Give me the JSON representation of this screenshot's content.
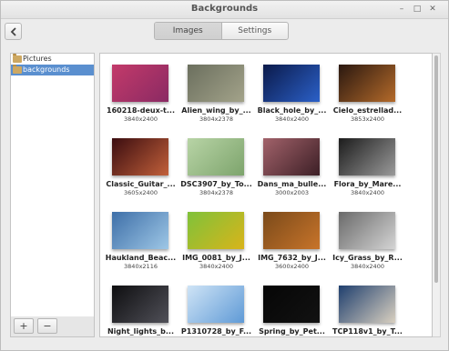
{
  "window": {
    "title": "Backgrounds"
  },
  "toolbar": {
    "tabs": [
      "Images",
      "Settings"
    ],
    "active_tab": "Images"
  },
  "sidebar": {
    "items": [
      {
        "label": "Pictures",
        "icon": "folder-icon"
      },
      {
        "label": "backgrounds",
        "icon": "folder-icon"
      }
    ],
    "buttons": {
      "add": "+",
      "remove": "−"
    }
  },
  "gallery": [
    {
      "name": "160218-deux-t...",
      "dims": "3840x2400",
      "colors": [
        "#c33a6a",
        "#8a2a63"
      ]
    },
    {
      "name": "Alien_wing_by_...",
      "dims": "3804x2378",
      "colors": [
        "#6b6f5e",
        "#a3a38a"
      ]
    },
    {
      "name": "Black_hole_by_...",
      "dims": "3840x2400",
      "colors": [
        "#0b1a4a",
        "#2b60c8"
      ]
    },
    {
      "name": "Cielo_estrellad...",
      "dims": "3853x2400",
      "colors": [
        "#2a1810",
        "#b46a2a"
      ]
    },
    {
      "name": "Classic_Guitar_...",
      "dims": "3605x2400",
      "colors": [
        "#3b0d10",
        "#c2603a"
      ]
    },
    {
      "name": "DSC3907_by_To...",
      "dims": "3804x2378",
      "colors": [
        "#b8d4a6",
        "#7da46c"
      ]
    },
    {
      "name": "Dans_ma_bulle...",
      "dims": "3000x2003",
      "colors": [
        "#a2626a",
        "#3c1f26"
      ]
    },
    {
      "name": "Flora_by_Mare...",
      "dims": "3840x2400",
      "colors": [
        "#1c1c1c",
        "#9a9a9a"
      ]
    },
    {
      "name": "Haukland_Beac...",
      "dims": "3840x2116",
      "colors": [
        "#3e6fa8",
        "#9ec7e6"
      ]
    },
    {
      "name": "IMG_0081_by_J...",
      "dims": "3840x2400",
      "colors": [
        "#7fc23a",
        "#d9b41a"
      ]
    },
    {
      "name": "IMG_7632_by_J...",
      "dims": "3600x2400",
      "colors": [
        "#7a4a1a",
        "#c8742a"
      ]
    },
    {
      "name": "Icy_Grass_by_R...",
      "dims": "3840x2400",
      "colors": [
        "#6a6a6a",
        "#d4d4d4"
      ]
    },
    {
      "name": "Night_lights_b...",
      "dims": "",
      "colors": [
        "#0e0e10",
        "#505058"
      ]
    },
    {
      "name": "P1310728_by_F...",
      "dims": "",
      "colors": [
        "#cfe4f6",
        "#5f9ad6"
      ]
    },
    {
      "name": "Spring_by_Pet...",
      "dims": "",
      "colors": [
        "#060606",
        "#121212"
      ]
    },
    {
      "name": "TCP118v1_by_T...",
      "dims": "",
      "colors": [
        "#1f3f6e",
        "#d9d0c0"
      ]
    }
  ]
}
